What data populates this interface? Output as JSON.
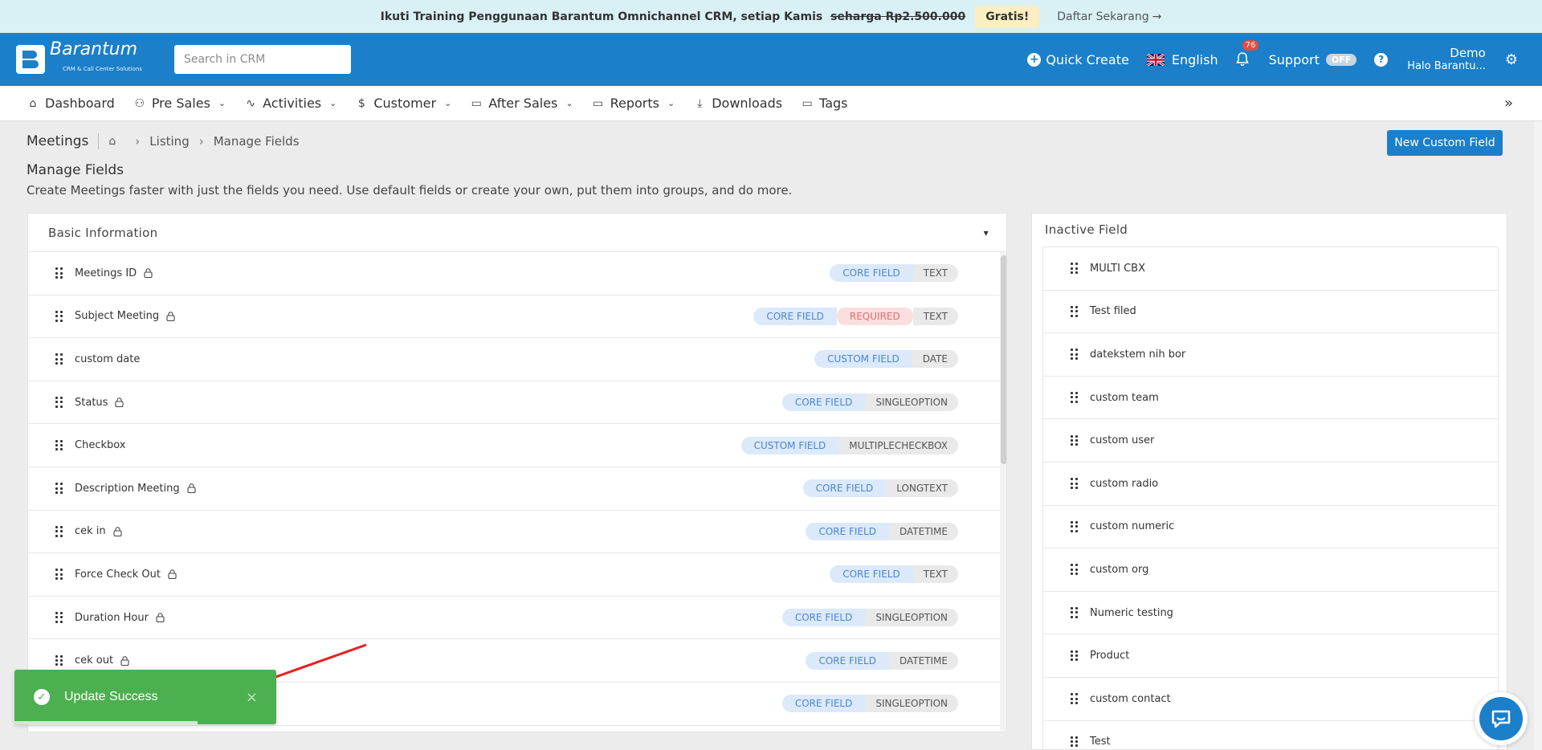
{
  "promo": {
    "message": "Ikuti Training Penggunaan Barantum Omnichannel CRM, setiap Kamis",
    "old_price": "seharga Rp2.500.000",
    "badge": "Gratis!",
    "cta": "Daftar Sekarang",
    "cta_arrow": "→"
  },
  "header": {
    "brand": "Barantum",
    "tagline": "CRM & Call Center Solutions",
    "search_placeholder": "Search in CRM",
    "quick_create": "Quick Create",
    "language": "English",
    "notification_count": "76",
    "support": "Support",
    "support_toggle": "OFF",
    "help": "?",
    "user_name": "Demo",
    "user_greeting": "Halo Barantu..."
  },
  "nav": {
    "items": [
      {
        "label": "Dashboard",
        "icon": "home-icon",
        "dropdown": false
      },
      {
        "label": "Pre Sales",
        "icon": "users-icon",
        "dropdown": true
      },
      {
        "label": "Activities",
        "icon": "activity-icon",
        "dropdown": true
      },
      {
        "label": "Customer",
        "icon": "dollar-icon",
        "dropdown": true
      },
      {
        "label": "After Sales",
        "icon": "folder-icon",
        "dropdown": true
      },
      {
        "label": "Reports",
        "icon": "folder-icon",
        "dropdown": true
      },
      {
        "label": "Downloads",
        "icon": "download-icon",
        "dropdown": false
      },
      {
        "label": "Tags",
        "icon": "folder-icon",
        "dropdown": false
      }
    ],
    "collapse": "»"
  },
  "page": {
    "module": "Meetings",
    "breadcrumbs": [
      "Listing",
      "Manage Fields"
    ],
    "new_button": "New Custom Field",
    "title": "Manage Fields",
    "description": "Create Meetings faster with just the fields you need. Use default fields or create your own, put them into groups, and do more."
  },
  "basic_panel": {
    "title": "Basic Information",
    "fields": [
      {
        "name": "Meetings ID",
        "locked": true,
        "kind": "CORE FIELD",
        "required": false,
        "type": "TEXT"
      },
      {
        "name": "Subject Meeting",
        "locked": true,
        "kind": "CORE FIELD",
        "required": true,
        "required_label": "REQUIRED",
        "type": "TEXT"
      },
      {
        "name": "custom date",
        "locked": false,
        "kind": "CUSTOM FIELD",
        "required": false,
        "type": "DATE"
      },
      {
        "name": "Status",
        "locked": true,
        "kind": "CORE FIELD",
        "required": false,
        "type": "SINGLEOPTION"
      },
      {
        "name": "Checkbox",
        "locked": false,
        "kind": "CUSTOM FIELD",
        "required": false,
        "type": "MULTIPLECHECKBOX"
      },
      {
        "name": "Description Meeting",
        "locked": true,
        "kind": "CORE FIELD",
        "required": false,
        "type": "LONGTEXT"
      },
      {
        "name": "cek in",
        "locked": true,
        "kind": "CORE FIELD",
        "required": false,
        "type": "DATETIME"
      },
      {
        "name": "Force Check Out",
        "locked": true,
        "kind": "CORE FIELD",
        "required": false,
        "type": "TEXT"
      },
      {
        "name": "Duration Hour",
        "locked": true,
        "kind": "CORE FIELD",
        "required": false,
        "type": "SINGLEOPTION"
      },
      {
        "name": "cek out",
        "locked": true,
        "kind": "CORE FIELD",
        "required": false,
        "type": "DATETIME"
      },
      {
        "name": "",
        "locked": false,
        "kind": "CORE FIELD",
        "required": false,
        "type": "SINGLEOPTION"
      }
    ]
  },
  "inactive_panel": {
    "title": "Inactive Field",
    "fields": [
      "MULTI CBX",
      "Test filed",
      "datekstem nih bor",
      "custom team",
      "custom user",
      "custom radio",
      "custom numeric",
      "custom org",
      "Numeric testing",
      "Product",
      "custom contact",
      "Test"
    ]
  },
  "toast": {
    "message": "Update Success",
    "close": "×",
    "progress": 0.7
  },
  "colors": {
    "primary": "#1b7fc9",
    "success": "#4caf50",
    "promo_bg": "#d9f1f5",
    "annotation": "#e8201c"
  }
}
